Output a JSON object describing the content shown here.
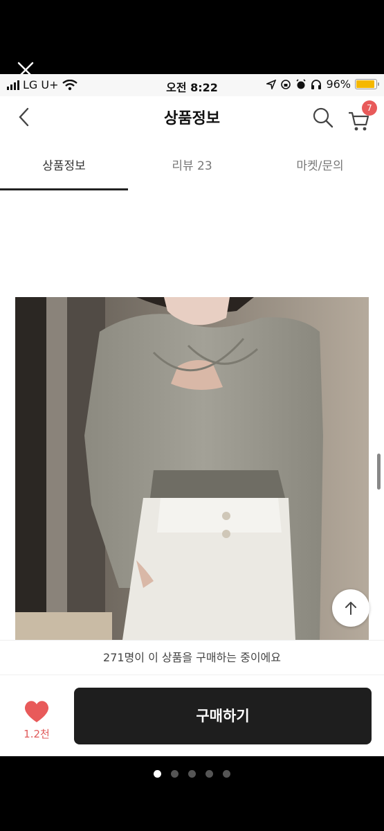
{
  "status_bar": {
    "carrier": "LG U+",
    "time": "오전 8:22",
    "battery": "96%",
    "battery_color": "#f5b800"
  },
  "header": {
    "title": "상품정보",
    "cart_count": "7",
    "back_icon": "chevron-left-icon",
    "search_icon": "search-icon",
    "cart_icon": "cart-icon"
  },
  "tabs": [
    {
      "label": "상품정보",
      "active": true
    },
    {
      "label": "리뷰 23",
      "active": false
    },
    {
      "label": "마켓/문의",
      "active": false
    }
  ],
  "notice": "271명이 이 상품을 구매하는 중이에요",
  "like": {
    "count": "1.2천",
    "color": "#e85a5a"
  },
  "buy_button": "구매하기",
  "pager": {
    "total": 5,
    "current": 1
  }
}
